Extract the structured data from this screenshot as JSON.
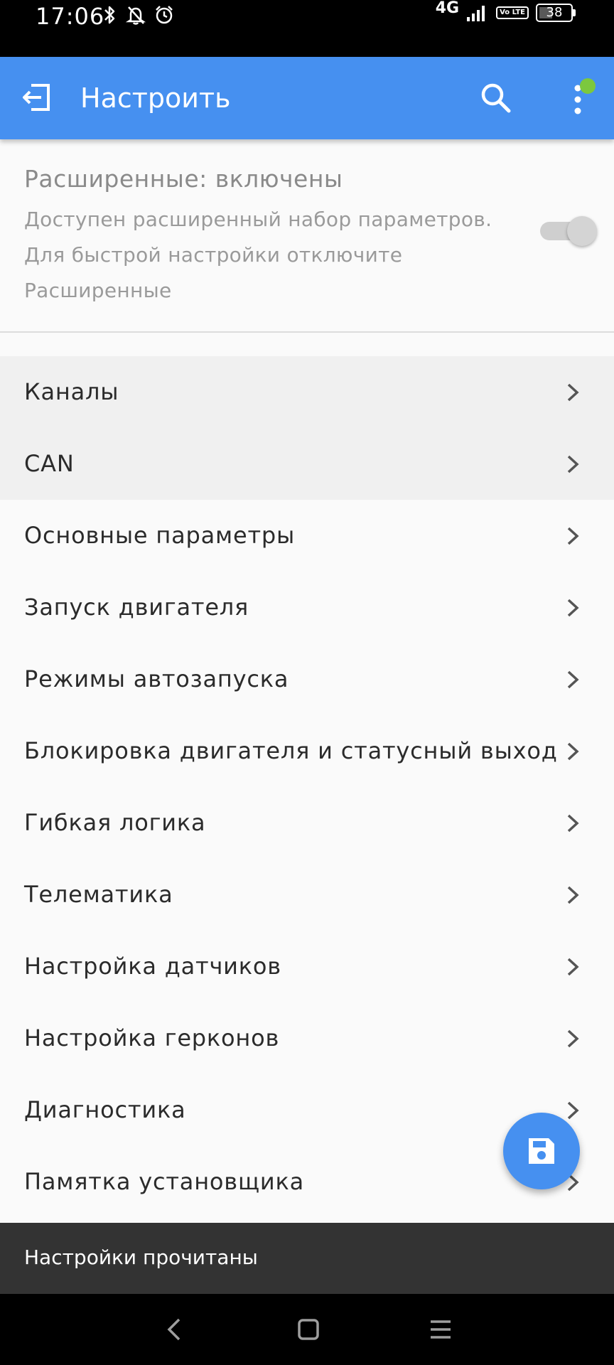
{
  "status_bar": {
    "time": "17:06",
    "network": "4G",
    "volte": "Vo LTE",
    "battery": "38"
  },
  "app_bar": {
    "title": "Настроить"
  },
  "advanced": {
    "title": "Расширенные: включены",
    "description": "Доступен расширенный набор параметров. Для быстрой настройки отключите Расширенные",
    "enabled": true
  },
  "menu": {
    "items": [
      {
        "label": "Каналы"
      },
      {
        "label": "CAN"
      },
      {
        "label": "Основные параметры"
      },
      {
        "label": "Запуск двигателя"
      },
      {
        "label": "Режимы автозапуска"
      },
      {
        "label": "Блокировка двигателя и статусный выход"
      },
      {
        "label": "Гибкая логика"
      },
      {
        "label": "Телематика"
      },
      {
        "label": "Настройка датчиков"
      },
      {
        "label": "Настройка герконов"
      },
      {
        "label": "Диагностика"
      },
      {
        "label": "Памятка установщика"
      }
    ]
  },
  "snackbar": {
    "message": "Настройки прочитаны"
  },
  "colors": {
    "primary": "#4690f0",
    "badge": "#7cc83e",
    "snackbar": "#333333"
  },
  "icons": {
    "back": "exit-arrow-icon",
    "search": "search-icon",
    "more": "more-vert-icon",
    "chevron": "chevron-right-icon",
    "fab": "save-icon"
  }
}
